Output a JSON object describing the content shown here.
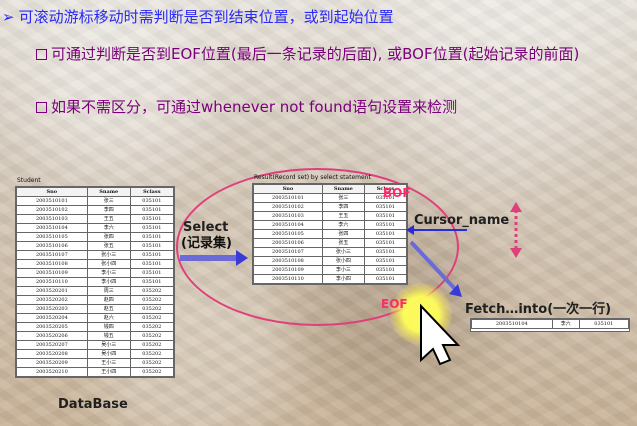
{
  "bullets": {
    "main": "可滚动游标移动时需判断是否到结束位置，或到起始位置",
    "item1": "可通过判断是否到EOF位置(最后一条记录的后面), 或BOF位置(起始记录的前面)",
    "item2": "如果不需区分，可通过whenever  not found语句设置来检测"
  },
  "student_table": {
    "title": "Student",
    "columns": [
      "Sno",
      "Sname",
      "Sclass"
    ],
    "rows": [
      [
        "2003510101",
        "张三",
        "035101"
      ],
      [
        "2003510102",
        "李四",
        "035101"
      ],
      [
        "2003510103",
        "王五",
        "035101"
      ],
      [
        "2003510104",
        "李六",
        "035101"
      ],
      [
        "2003510105",
        "张四",
        "035101"
      ],
      [
        "2003510106",
        "张五",
        "035101"
      ],
      [
        "2003510107",
        "张小三",
        "035101"
      ],
      [
        "2003510108",
        "张小四",
        "035101"
      ],
      [
        "2003510109",
        "李小三",
        "035101"
      ],
      [
        "2003510110",
        "李小四",
        "035101"
      ],
      [
        "2003520201",
        "周三",
        "035202"
      ],
      [
        "2003520202",
        "赵四",
        "035202"
      ],
      [
        "2003520203",
        "赵五",
        "035202"
      ],
      [
        "2003520204",
        "赵六",
        "035202"
      ],
      [
        "2003520205",
        "钱四",
        "035202"
      ],
      [
        "2003520206",
        "钱五",
        "035202"
      ],
      [
        "2003520207",
        "吴小三",
        "035202"
      ],
      [
        "2003520208",
        "吴小四",
        "035202"
      ],
      [
        "2003520209",
        "王小三",
        "035202"
      ],
      [
        "2003520210",
        "王小四",
        "035202"
      ]
    ]
  },
  "result_table": {
    "title": "Result(Record set) by select statement",
    "columns": [
      "Sno",
      "Sname",
      "Sclass"
    ],
    "rows": [
      [
        "2003510101",
        "张三",
        "035101"
      ],
      [
        "2003510102",
        "李四",
        "035101"
      ],
      [
        "2003510103",
        "王五",
        "035101"
      ],
      [
        "2003510104",
        "李六",
        "035101"
      ],
      [
        "2003510105",
        "张四",
        "035101"
      ],
      [
        "2003510106",
        "张五",
        "035101"
      ],
      [
        "2003510107",
        "张小三",
        "035101"
      ],
      [
        "2003510108",
        "张小四",
        "035101"
      ],
      [
        "2003510109",
        "李小三",
        "035101"
      ],
      [
        "2003510110",
        "李小四",
        "035101"
      ]
    ]
  },
  "fetch_table": {
    "row": [
      "2003510104",
      "李六",
      "035101"
    ]
  },
  "labels": {
    "select": "Select",
    "select_sub": "(记录集)",
    "cursor_name": "Cursor_name",
    "database": "DataBase",
    "fetch": "Fetch…into(一次一行)",
    "eof": "EOF",
    "bof": "BOF"
  },
  "colors": {
    "bullet_blue": "#2a2af5",
    "bullet_purple": "#7a007a",
    "highlight_pink": "#e0407a"
  }
}
